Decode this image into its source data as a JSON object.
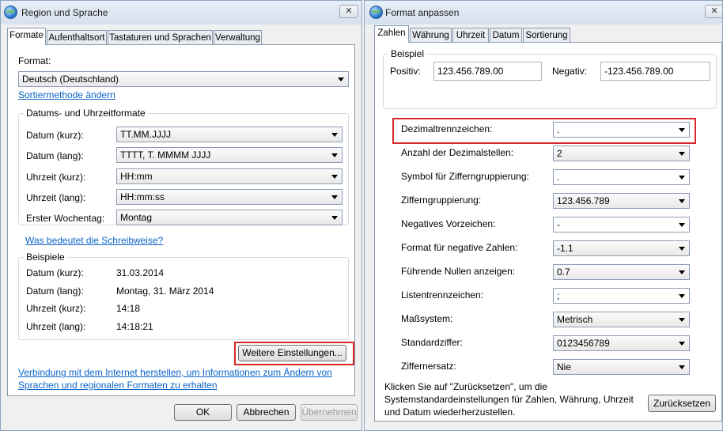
{
  "left_window": {
    "title": "Region und Sprache",
    "close_label": "✕",
    "tabs": [
      {
        "label": "Formate"
      },
      {
        "label": "Aufenthaltsort"
      },
      {
        "label": "Tastaturen und Sprachen"
      },
      {
        "label": "Verwaltung"
      }
    ],
    "format_label": "Format:",
    "format_value": "Deutsch (Deutschland)",
    "sort_link": "Sortiermethode ändern",
    "datetime_group_title": "Datums- und Uhrzeitformate",
    "datetime_rows": [
      {
        "label": "Datum (kurz):",
        "value": "TT.MM.JJJJ"
      },
      {
        "label": "Datum (lang):",
        "value": "TTTT, T. MMMM JJJJ"
      },
      {
        "label": "Uhrzeit (kurz):",
        "value": "HH:mm"
      },
      {
        "label": "Uhrzeit (lang):",
        "value": "HH:mm:ss"
      },
      {
        "label": "Erster Wochentag:",
        "value": "Montag"
      }
    ],
    "notation_link": "Was bedeutet die Schreibweise?",
    "examples_group_title": "Beispiele",
    "examples": [
      {
        "label": "Datum (kurz):",
        "value": "31.03.2014"
      },
      {
        "label": "Datum (lang):",
        "value": "Montag, 31. März 2014"
      },
      {
        "label": "Uhrzeit (kurz):",
        "value": "14:18"
      },
      {
        "label": "Uhrzeit (lang):",
        "value": "14:18:21"
      }
    ],
    "more_settings_button": "Weitere Einstellungen...",
    "internet_link_line1": "Verbindung mit dem Internet herstellen, um Informationen zum Ändern von",
    "internet_link_line2": "Sprachen und regionalen Formaten zu erhalten",
    "ok_button": "OK",
    "cancel_button": "Abbrechen",
    "apply_button": "Übernehmen"
  },
  "right_window": {
    "title": "Format anpassen",
    "close_label": "✕",
    "tabs": [
      {
        "label": "Zahlen"
      },
      {
        "label": "Währung"
      },
      {
        "label": "Uhrzeit"
      },
      {
        "label": "Datum"
      },
      {
        "label": "Sortierung"
      }
    ],
    "example_group_title": "Beispiel",
    "positive_label": "Positiv:",
    "positive_value": "123.456.789.00",
    "negative_label": "Negativ:",
    "negative_value": "-123.456.789.00",
    "settings": [
      {
        "label": "Dezimaltrennzeichen:",
        "value": "."
      },
      {
        "label": "Anzahl der Dezimalstellen:",
        "value": "2"
      },
      {
        "label": "Symbol für Zifferngruppierung:",
        "value": "."
      },
      {
        "label": "Zifferngruppierung:",
        "value": "123.456.789"
      },
      {
        "label": "Negatives Vorzeichen:",
        "value": "-"
      },
      {
        "label": "Format für negative Zahlen:",
        "value": "-1.1"
      },
      {
        "label": "Führende Nullen anzeigen:",
        "value": "0.7"
      },
      {
        "label": "Listentrennzeichen:",
        "value": ";"
      },
      {
        "label": "Maßsystem:",
        "value": "Metrisch"
      },
      {
        "label": "Standardziffer:",
        "value": "0123456789"
      },
      {
        "label": "Ziffernersatz:",
        "value": "Nie"
      }
    ],
    "reset_text_line1": "Klicken Sie auf \"Zurücksetzen\", um die",
    "reset_text_line2": "Systemstandardeinstellungen für Zahlen, Währung, Uhrzeit",
    "reset_text_line3": "und Datum wiederherzustellen.",
    "reset_button": "Zurücksetzen"
  }
}
